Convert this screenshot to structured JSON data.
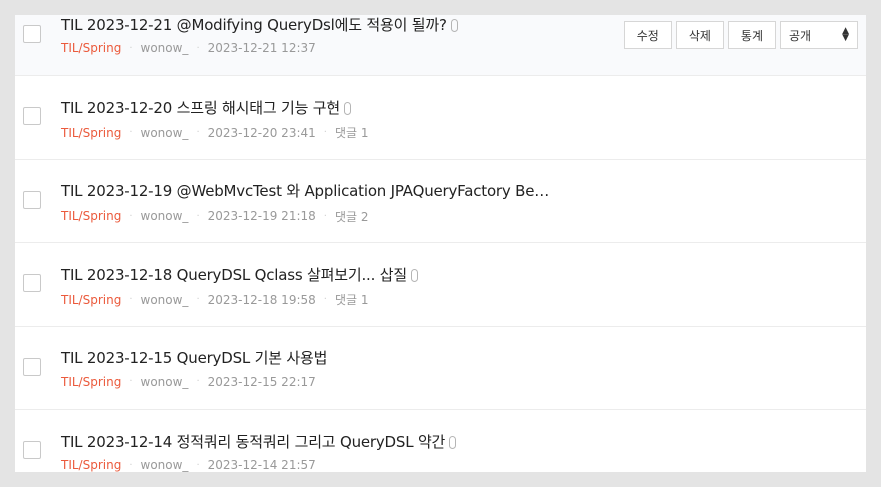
{
  "posts": [
    {
      "title": "TIL 2023-12-21 @Modifying QueryDsl에도 적용이 될까?",
      "category": "TIL/Spring",
      "author": "wonow_",
      "datetime": "2023-12-21 12:37",
      "comments": "",
      "attachment": true
    },
    {
      "title": "TIL 2023-12-20 스프링 해시태그 기능 구현",
      "category": "TIL/Spring",
      "author": "wonow_",
      "datetime": "2023-12-20 23:41",
      "comments": "댓글 1",
      "attachment": true
    },
    {
      "title": "TIL 2023-12-19 @WebMvcTest 와 Application JPAQueryFactory Be…",
      "category": "TIL/Spring",
      "author": "wonow_",
      "datetime": "2023-12-19 21:18",
      "comments": "댓글 2",
      "attachment": false
    },
    {
      "title": "TIL 2023-12-18 QueryDSL Qclass 살펴보기... 삽질",
      "category": "TIL/Spring",
      "author": "wonow_",
      "datetime": "2023-12-18 19:58",
      "comments": "댓글 1",
      "attachment": true
    },
    {
      "title": "TIL 2023-12-15 QueryDSL 기본 사용법",
      "category": "TIL/Spring",
      "author": "wonow_",
      "datetime": "2023-12-15 22:17",
      "comments": "",
      "attachment": false
    },
    {
      "title": "TIL 2023-12-14 정적쿼리 동적쿼리 그리고 QueryDSL 약간",
      "category": "TIL/Spring",
      "author": "wonow_",
      "datetime": "2023-12-14 21:57",
      "comments": "",
      "attachment": true
    }
  ],
  "actions": {
    "edit_label": "수정",
    "delete_label": "삭제",
    "stats_label": "통계",
    "visibility_value": "공개"
  }
}
